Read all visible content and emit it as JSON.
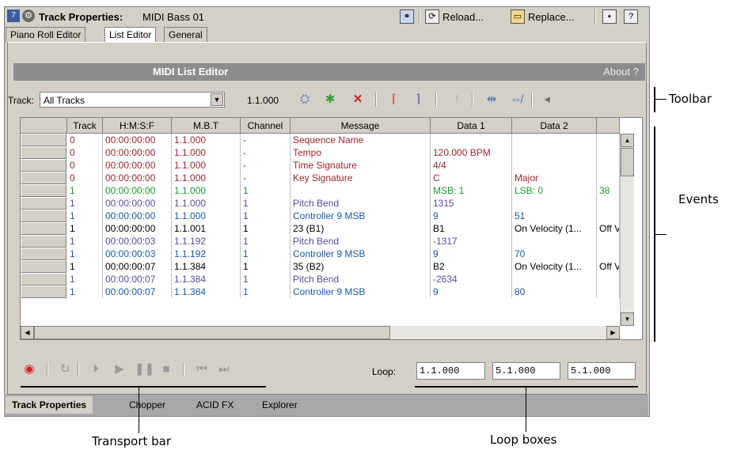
{
  "title": {
    "prefix": "Track Properties:",
    "name": "MIDI Bass 01",
    "badge": "7"
  },
  "title_buttons": {
    "reload": "Reload...",
    "replace": "Replace..."
  },
  "tabs_top": [
    "Piano Roll Editor",
    "List Editor",
    "General"
  ],
  "header": {
    "title": "MIDI List Editor",
    "about": "About ?"
  },
  "toolbar": {
    "track_label": "Track:",
    "track_value": "All Tracks",
    "position": "1.1.000"
  },
  "grid": {
    "columns": [
      "Track",
      "H:M:S:F",
      "M.B.T",
      "Channel",
      "Message",
      "Data 1",
      "Data 2"
    ],
    "rows": [
      {
        "track": "0",
        "hmsf": "00:00:00:00",
        "mbt": "1.1.000",
        "channel": "-",
        "message": "Sequence Name",
        "data1": "",
        "data2": "",
        "extra": "",
        "color": "#a0262e"
      },
      {
        "track": "0",
        "hmsf": "00:00:00:00",
        "mbt": "1.1.000",
        "channel": "-",
        "message": "Tempo",
        "data1": "120.000 BPM",
        "data2": "",
        "extra": "",
        "color": "#a0262e"
      },
      {
        "track": "0",
        "hmsf": "00:00:00:00",
        "mbt": "1.1.000",
        "channel": "-",
        "message": "Time Signature",
        "data1": "4/4",
        "data2": "",
        "extra": "",
        "color": "#a0262e"
      },
      {
        "track": "0",
        "hmsf": "00:00:00:00",
        "mbt": "1.1.000",
        "channel": "-",
        "message": "Key Signature",
        "data1": "C",
        "data2": "Major",
        "extra": "",
        "color": "#a0262e"
      },
      {
        "track": "1",
        "hmsf": "00:00:00:00",
        "mbt": "1.1.000",
        "channel": "1",
        "message": "",
        "data1": "MSB: 1",
        "data2": "LSB: 0",
        "extra": "38",
        "color": "#1a9a2a"
      },
      {
        "track": "1",
        "hmsf": "00:00:00:00",
        "mbt": "1.1.000",
        "channel": "1",
        "message": "Pitch Bend",
        "data1": "1315",
        "data2": "",
        "extra": "",
        "color": "#5a4aa0"
      },
      {
        "track": "1",
        "hmsf": "00:00:00:00",
        "mbt": "1.1.000",
        "channel": "1",
        "message": "Controller 9 MSB",
        "data1": "9",
        "data2": "51",
        "extra": "",
        "color": "#1a5aa8"
      },
      {
        "track": "1",
        "hmsf": "00:00:00:00",
        "mbt": "1.1.001",
        "channel": "1",
        "message": "23 (B1)",
        "data1": "B1",
        "data2": "On Velocity (1...",
        "extra": "Off V",
        "color": "#000000"
      },
      {
        "track": "1",
        "hmsf": "00:00:00:03",
        "mbt": "1.1.192",
        "channel": "1",
        "message": "Pitch Bend",
        "data1": "-1317",
        "data2": "",
        "extra": "",
        "color": "#5a4aa0"
      },
      {
        "track": "1",
        "hmsf": "00:00:00:03",
        "mbt": "1.1.192",
        "channel": "1",
        "message": "Controller 9 MSB",
        "data1": "9",
        "data2": "70",
        "extra": "",
        "color": "#1a5aa8"
      },
      {
        "track": "1",
        "hmsf": "00:00:00:07",
        "mbt": "1.1.384",
        "channel": "1",
        "message": "35 (B2)",
        "data1": "B2",
        "data2": "On Velocity (1...",
        "extra": "Off V",
        "color": "#000000"
      },
      {
        "track": "1",
        "hmsf": "00:00:00:07",
        "mbt": "1.1.384",
        "channel": "1",
        "message": "Pitch Bend",
        "data1": "-2634",
        "data2": "",
        "extra": "",
        "color": "#5a4aa0"
      },
      {
        "track": "1",
        "hmsf": "00:00:00:07",
        "mbt": "1.1.384",
        "channel": "1",
        "message": "Controller 9 MSB",
        "data1": "9",
        "data2": "80",
        "extra": "",
        "color": "#1a5aa8"
      }
    ]
  },
  "loop": {
    "label": "Loop:",
    "start": "1.1.000",
    "end": "5.1.000",
    "length": "5.1.000"
  },
  "bottom_tabs": [
    "Track Properties",
    "Chopper",
    "ACID FX",
    "Explorer"
  ],
  "callouts": {
    "toolbar": "Toolbar",
    "events": "Events",
    "transport": "Transport bar",
    "loop_boxes": "Loop boxes"
  }
}
